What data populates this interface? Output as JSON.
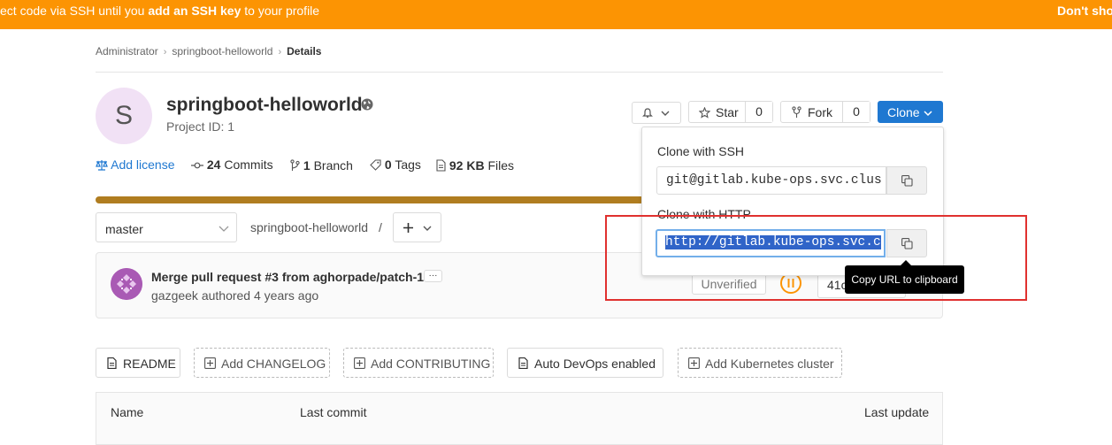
{
  "banner": {
    "prefix": "ect code via SSH until you ",
    "link": "add an SSH key",
    "suffix": " to your profile",
    "dismiss": "Don't sho"
  },
  "breadcrumb": {
    "items": [
      "Administrator",
      "springboot-helloworld"
    ],
    "current": "Details"
  },
  "project": {
    "avatar_letter": "S",
    "name": "springboot-helloworld",
    "id_label": "Project ID: 1"
  },
  "actions": {
    "star_label": "Star",
    "star_count": "0",
    "fork_label": "Fork",
    "fork_count": "0",
    "clone_label": "Clone"
  },
  "stats": {
    "add_license": "Add license",
    "commits_count": "24",
    "commits_label": "Commits",
    "branch_count": "1",
    "branch_label": "Branch",
    "tags_count": "0",
    "tags_label": "Tags",
    "files_size": "92 KB",
    "files_label": "Files"
  },
  "repo": {
    "branch": "master",
    "path": "springboot-helloworld",
    "path_sep": "/"
  },
  "commit": {
    "title": "Merge pull request #3 from aghorpade/patch-1",
    "more": "···",
    "author_line": "gazgeek authored 4 years ago",
    "signature": "Unverified",
    "sha": "41c"
  },
  "quick_buttons": [
    {
      "label": "README",
      "style": "solid"
    },
    {
      "label": "Add CHANGELOG",
      "style": "dash"
    },
    {
      "label": "Add CONTRIBUTING",
      "style": "dash"
    },
    {
      "label": "Auto DevOps enabled",
      "style": "solid"
    },
    {
      "label": "Add Kubernetes cluster",
      "style": "dash"
    }
  ],
  "files_table": {
    "headers": [
      "Name",
      "Last commit",
      "Last update"
    ]
  },
  "clone_dropdown": {
    "ssh_heading": "Clone with SSH",
    "ssh_url": "git@gitlab.kube-ops.svc.clus",
    "http_heading": "Clone with HTTP",
    "http_url": "http://gitlab.kube-ops.svc.c"
  },
  "tooltip": "Copy URL to clipboard",
  "colors": {
    "banner": "#fc9403",
    "primary": "#1f78d1",
    "progress": "#b07d20",
    "highlight": "#e0312f"
  }
}
